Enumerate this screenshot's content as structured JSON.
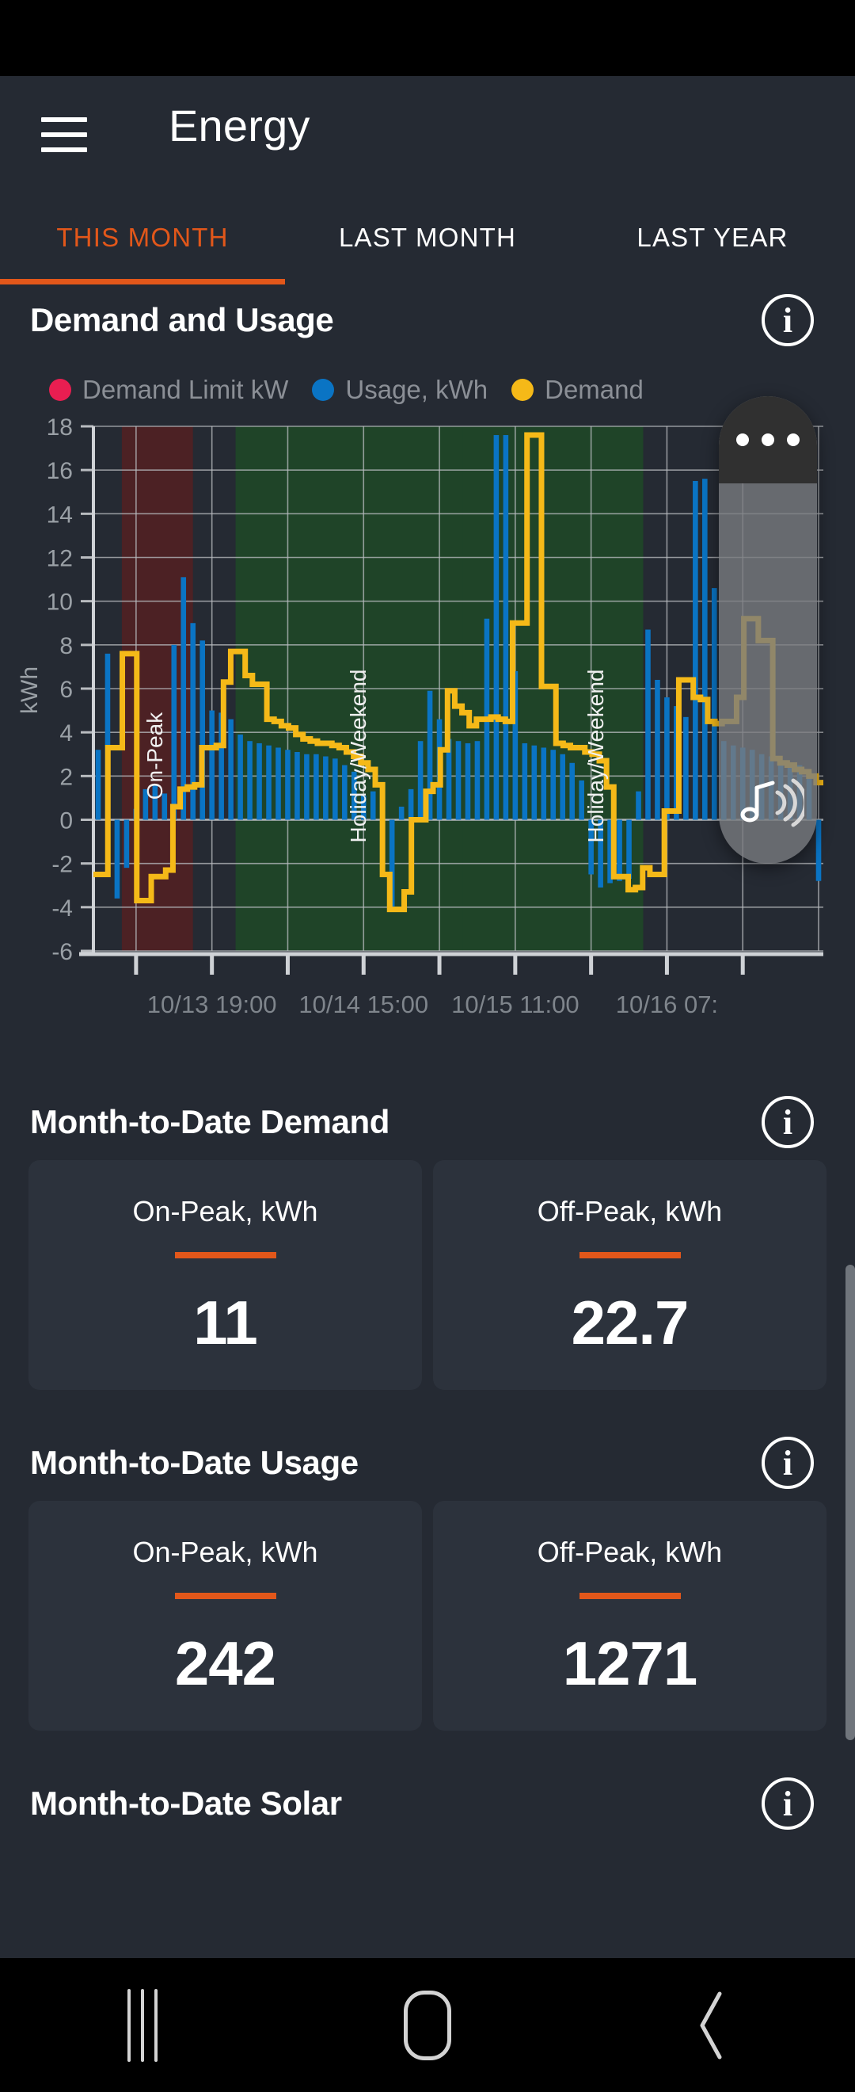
{
  "app": {
    "title": "Energy",
    "menu_icon": "hamburger-icon"
  },
  "tabs": [
    {
      "label": "THIS MONTH",
      "active": true
    },
    {
      "label": "LAST MONTH",
      "active": false
    },
    {
      "label": "LAST YEAR",
      "active": false
    }
  ],
  "colors": {
    "accent": "#e2571a",
    "background": "#252a33",
    "card": "#2c323c",
    "demand_limit": "#e91e51",
    "usage": "#0a74c4",
    "demand": "#f5b918",
    "onpeak_band": "#4c2124",
    "holiday_band": "#1f4428"
  },
  "sections": [
    {
      "title": "Demand and Usage",
      "info_label": "i"
    },
    {
      "title": "Month-to-Date Demand",
      "info_label": "i"
    },
    {
      "title": "Month-to-Date Usage",
      "info_label": "i"
    },
    {
      "title": "Month-to-Date Solar",
      "info_label": "i"
    }
  ],
  "mtd_demand": {
    "title": "Month-to-Date Demand",
    "cards": [
      {
        "label": "On-Peak, kWh",
        "value": "11"
      },
      {
        "label": "Off-Peak, kWh",
        "value": "22.7"
      }
    ]
  },
  "mtd_usage": {
    "title": "Month-to-Date Usage",
    "cards": [
      {
        "label": "On-Peak, kWh",
        "value": "242"
      },
      {
        "label": "Off-Peak, kWh",
        "value": "1271"
      }
    ]
  },
  "mtd_solar": {
    "title": "Month-to-Date Solar"
  },
  "overlay": {
    "menu_icon": "more-dots-icon",
    "media_icon": "music-note-volume-icon"
  },
  "navbar": {
    "recents": "recents-icon",
    "home": "home-icon",
    "back": "back-icon"
  },
  "chart_data": {
    "type": "bar",
    "title": "Demand and Usage",
    "xlabel": "",
    "ylabel": "kWh",
    "ylim": [
      -6,
      18
    ],
    "yticks": [
      -6,
      -4,
      -2,
      0,
      2,
      4,
      6,
      8,
      10,
      12,
      14,
      16,
      18
    ],
    "xtick_labels": [
      "10/13 19:00",
      "10/14 15:00",
      "10/15 11:00",
      "10/16 07:"
    ],
    "xtick_positions": [
      12,
      28,
      44,
      60
    ],
    "grid": true,
    "legend_position": "top-left",
    "legend": [
      {
        "name": "Demand Limit kW",
        "color": "#e91e51",
        "marker": "circle"
      },
      {
        "name": "Usage, kWh",
        "color": "#0a74c4",
        "marker": "circle"
      },
      {
        "name": "Demand",
        "color": "#f5b918",
        "marker": "circle",
        "truncated": true
      }
    ],
    "bands": [
      {
        "label": "On-Peak",
        "color": "#4c2124",
        "x_start": 3.0,
        "x_end": 10.5
      },
      {
        "label": "Holiday/Weekend",
        "color": "#1f4428",
        "x_start": 15.0,
        "x_end": 39.0
      },
      {
        "label": "Holiday/Weekend",
        "color": "#1f4428",
        "x_start": 39.0,
        "x_end": 58.0
      }
    ],
    "series": [
      {
        "name": "Usage, kWh",
        "color": "#0a74c4",
        "type": "bar",
        "values": [
          3.2,
          7.6,
          -3.6,
          -2.2,
          0.5,
          1.4,
          1.6,
          1.2,
          8.0,
          11.1,
          9.0,
          8.2,
          5.0,
          4.9,
          4.6,
          3.9,
          3.6,
          3.5,
          3.4,
          3.3,
          3.2,
          3.1,
          3.0,
          3.0,
          2.9,
          2.8,
          2.5,
          2.2,
          1.1,
          1.3,
          -2.4,
          -4.1,
          0.6,
          1.4,
          3.6,
          5.9,
          4.6,
          3.7,
          3.6,
          3.5,
          3.6,
          9.2,
          17.6,
          17.6,
          6.8,
          3.5,
          3.4,
          3.3,
          3.2,
          3.0,
          2.6,
          1.8,
          -2.5,
          -3.1,
          -2.9,
          -2.8,
          -2.7,
          1.3,
          8.7,
          6.4,
          5.6,
          5.2,
          4.7,
          15.5,
          15.6,
          10.6,
          3.6,
          3.4,
          3.3,
          3.2,
          3.0,
          2.9,
          2.7,
          2.6,
          2.5,
          2.2,
          -2.8
        ],
        "bar_width": 0.55
      },
      {
        "name": "Demand",
        "color": "#f5b918",
        "type": "step",
        "values": [
          -2.5,
          -2.5,
          3.3,
          3.3,
          7.6,
          7.6,
          -3.7,
          -3.7,
          -2.6,
          -2.6,
          -2.3,
          0.6,
          1.4,
          1.5,
          1.6,
          3.3,
          3.3,
          3.4,
          6.3,
          7.7,
          7.7,
          6.6,
          6.2,
          6.2,
          4.6,
          4.5,
          4.3,
          4.2,
          3.9,
          3.7,
          3.6,
          3.5,
          3.5,
          3.4,
          3.3,
          3.1,
          2.9,
          2.6,
          2.3,
          1.6,
          -2.5,
          -4.1,
          -4.1,
          -3.3,
          0.0,
          0.0,
          1.3,
          1.6,
          3.2,
          5.9,
          5.2,
          4.9,
          4.3,
          4.6,
          4.6,
          4.7,
          4.6,
          4.5,
          9.0,
          9.0,
          17.6,
          17.6,
          6.1,
          6.1,
          3.5,
          3.4,
          3.3,
          3.3,
          3.1,
          3.0,
          2.7,
          1.5,
          -2.6,
          -2.6,
          -3.2,
          -3.1,
          -2.2,
          -2.5,
          -2.5,
          0.4,
          0.4,
          6.4,
          6.4,
          5.6,
          5.5,
          4.5,
          4.4,
          4.5,
          4.5,
          5.6,
          9.2,
          9.2,
          8.2,
          8.2,
          2.8,
          2.6,
          2.5,
          2.3,
          2.2,
          2.0,
          1.7
        ]
      }
    ]
  }
}
